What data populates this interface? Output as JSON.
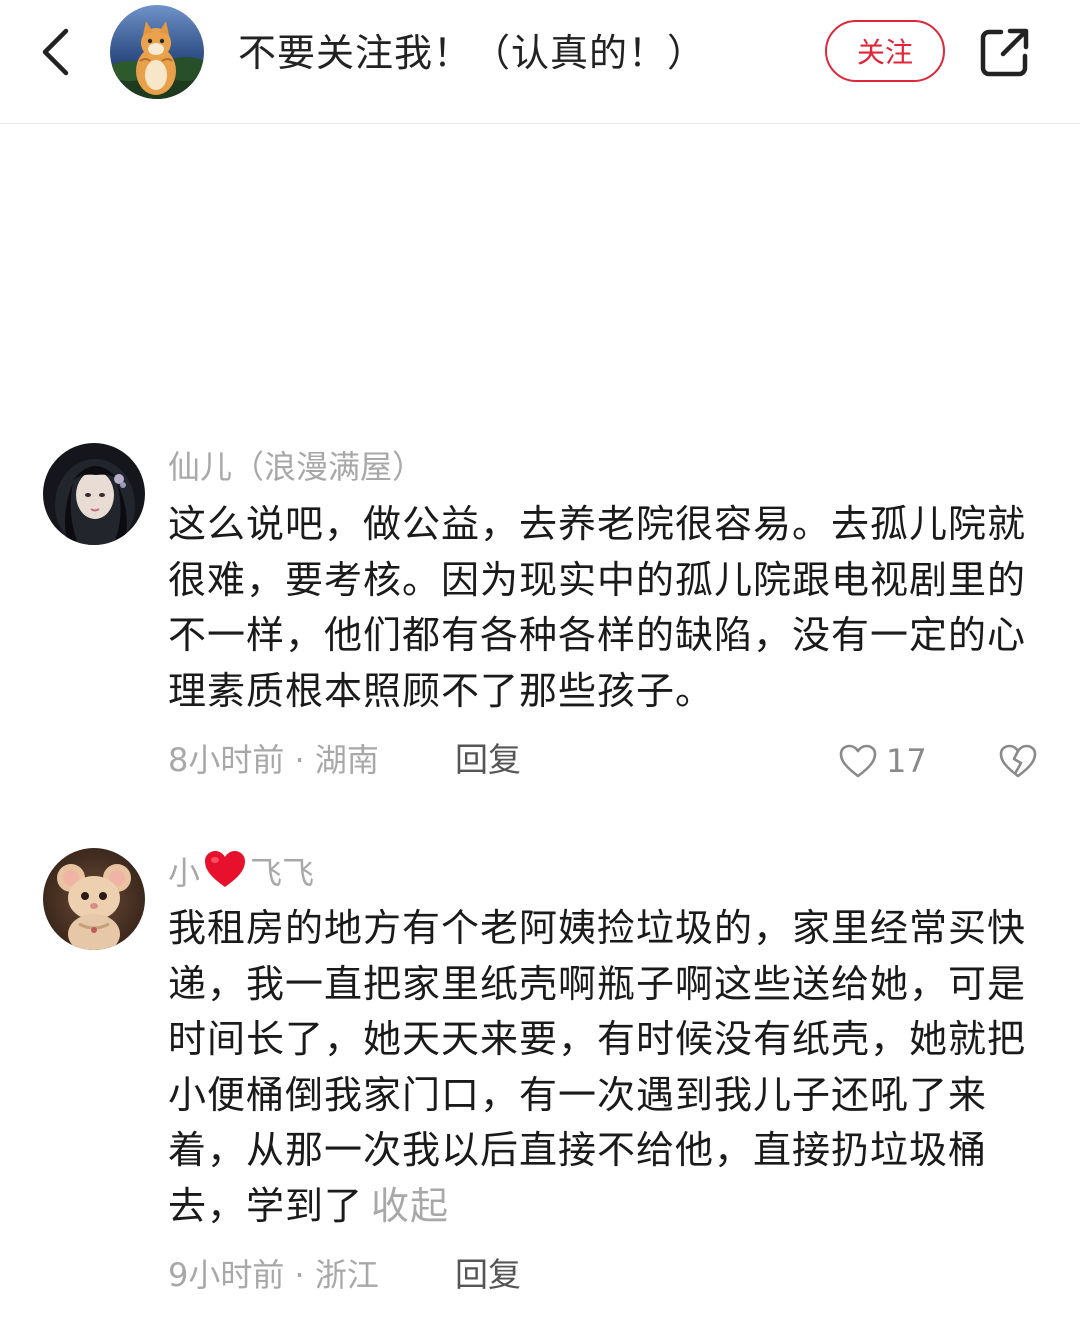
{
  "header": {
    "back_icon": "chevron-left-icon",
    "title": "不要关注我！（认真的！）",
    "follow_label": "关注",
    "share_icon": "share-icon"
  },
  "colors": {
    "accent": "#e0263a",
    "meta_text": "#a8a8a8",
    "body_text": "#1a1a1a"
  },
  "comments": [
    {
      "author": "仙儿（浪漫满屋）",
      "text": "这么说吧，做公益，去养老院很容易。去孤儿院就很难，要考核。因为现实中的孤儿院跟电视剧里的不一样，他们都有各种各样的缺陷，没有一定的心理素质根本照顾不了那些孩子。",
      "meta": "8小时前 · 湖南",
      "reply_label": "回复",
      "like_count": "17",
      "like_icon": "heart-outline-icon",
      "dislike_icon": "broken-heart-icon"
    },
    {
      "author_prefix": "小",
      "author_suffix": "飞飞",
      "author_emoji": "red-heart-icon",
      "text": "我租房的地方有个老阿姨捡垃圾的，家里经常买快递，我一直把家里纸壳啊瓶子啊这些送给她，可是时间长了，她天天来要，有时候没有纸壳，她就把小便桶倒我家门口，有一次遇到我儿子还吼了来着，从那一次我以后直接不给他，直接扔垃圾桶去，学到了",
      "collapse_label": "收起",
      "meta": "9小时前 · 浙江",
      "reply_label": "回复"
    }
  ]
}
